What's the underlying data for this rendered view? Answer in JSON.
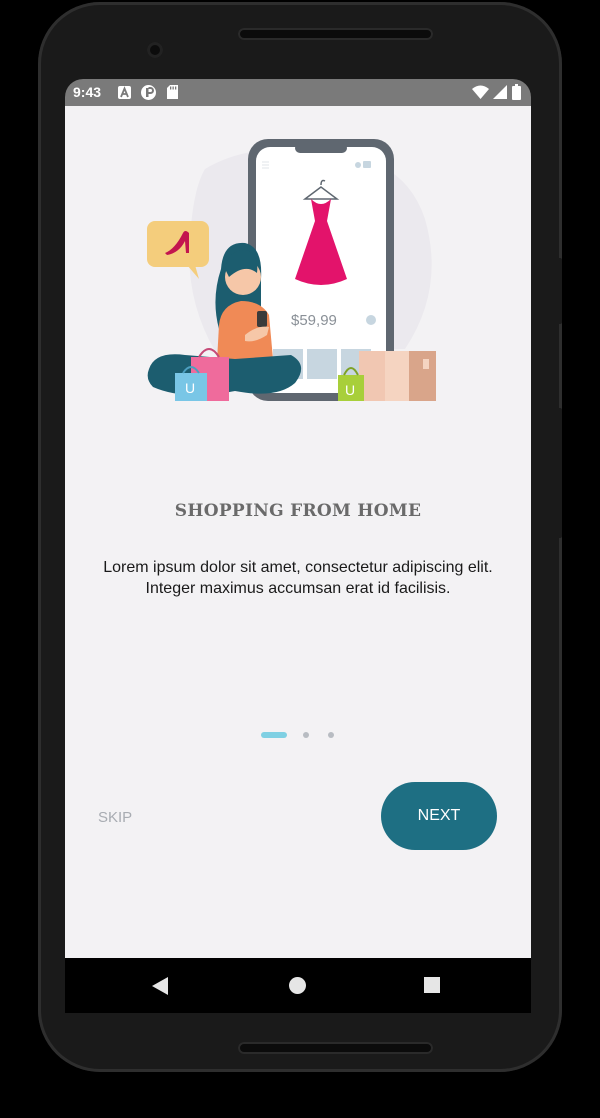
{
  "status_bar": {
    "time": "9:43",
    "left_icons": [
      "a-icon",
      "sync-icon",
      "sd-card-icon"
    ],
    "right_icons": [
      "wifi-icon",
      "signal-icon",
      "battery-icon"
    ]
  },
  "onboarding": {
    "illustration": {
      "price": "$59,99"
    },
    "title": "SHOPPING FROM HOME",
    "description": "Lorem ipsum dolor sit amet, consectetur adipiscing elit. Integer maximus accumsan erat id facilisis.",
    "page_indicator": {
      "current": 1,
      "total": 3
    },
    "skip_label": "SKIP",
    "next_label": "NEXT"
  },
  "nav_bar": {
    "buttons": [
      "back-icon",
      "home-icon",
      "recents-icon"
    ]
  },
  "colors": {
    "background": "#f3f2f4",
    "accent": "#1e6f83",
    "indicator_active": "#7fd0e3",
    "indicator_inactive": "#b8bcc2",
    "status_bar": "#7a7a7a"
  }
}
